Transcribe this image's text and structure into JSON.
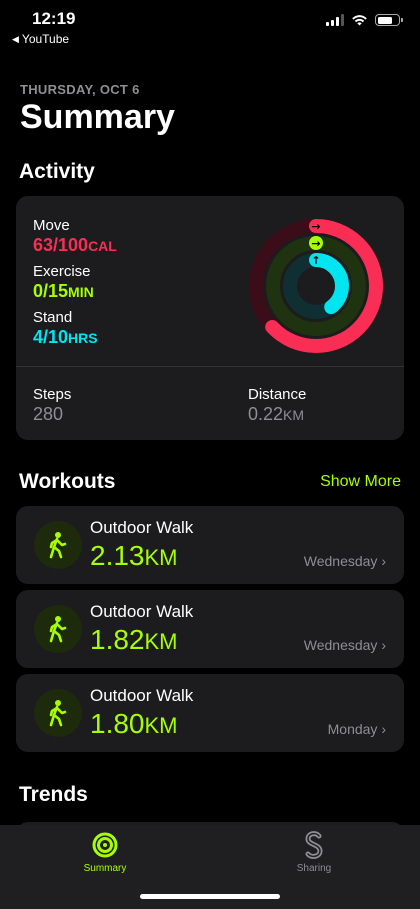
{
  "status_bar": {
    "time": "12:19",
    "back_app": "YouTube"
  },
  "header": {
    "date": "THURSDAY, OCT 6",
    "title": "Summary"
  },
  "activity": {
    "section_title": "Activity",
    "move": {
      "label": "Move",
      "value": "63/100",
      "unit": "CAL",
      "color": "#fa2d55",
      "progress": 0.63
    },
    "exercise": {
      "label": "Exercise",
      "value": "0/15",
      "unit": "MIN",
      "color": "#a6ff00",
      "progress": 0.0
    },
    "stand": {
      "label": "Stand",
      "value": "4/10",
      "unit": "HRS",
      "color": "#00e5f0",
      "progress": 0.4
    },
    "steps": {
      "label": "Steps",
      "value": "280"
    },
    "distance": {
      "label": "Distance",
      "value": "0.22",
      "unit": "KM"
    }
  },
  "workouts": {
    "section_title": "Workouts",
    "show_more": "Show More",
    "items": [
      {
        "name": "Outdoor Walk",
        "value": "2.13",
        "unit": "KM",
        "day": "Wednesday",
        "chevron": "›"
      },
      {
        "name": "Outdoor Walk",
        "value": "1.82",
        "unit": "KM",
        "day": "Wednesday",
        "chevron": "›"
      },
      {
        "name": "Outdoor Walk",
        "value": "1.80",
        "unit": "KM",
        "day": "Monday",
        "chevron": "›"
      }
    ]
  },
  "trends": {
    "section_title": "Trends"
  },
  "tabbar": {
    "tabs": [
      {
        "label": "Summary",
        "icon": "activity-rings-icon",
        "active": true,
        "color": "#a6ff00"
      },
      {
        "label": "Sharing",
        "icon": "sharing-s-icon",
        "active": false,
        "color": "#8e8e93"
      }
    ]
  }
}
